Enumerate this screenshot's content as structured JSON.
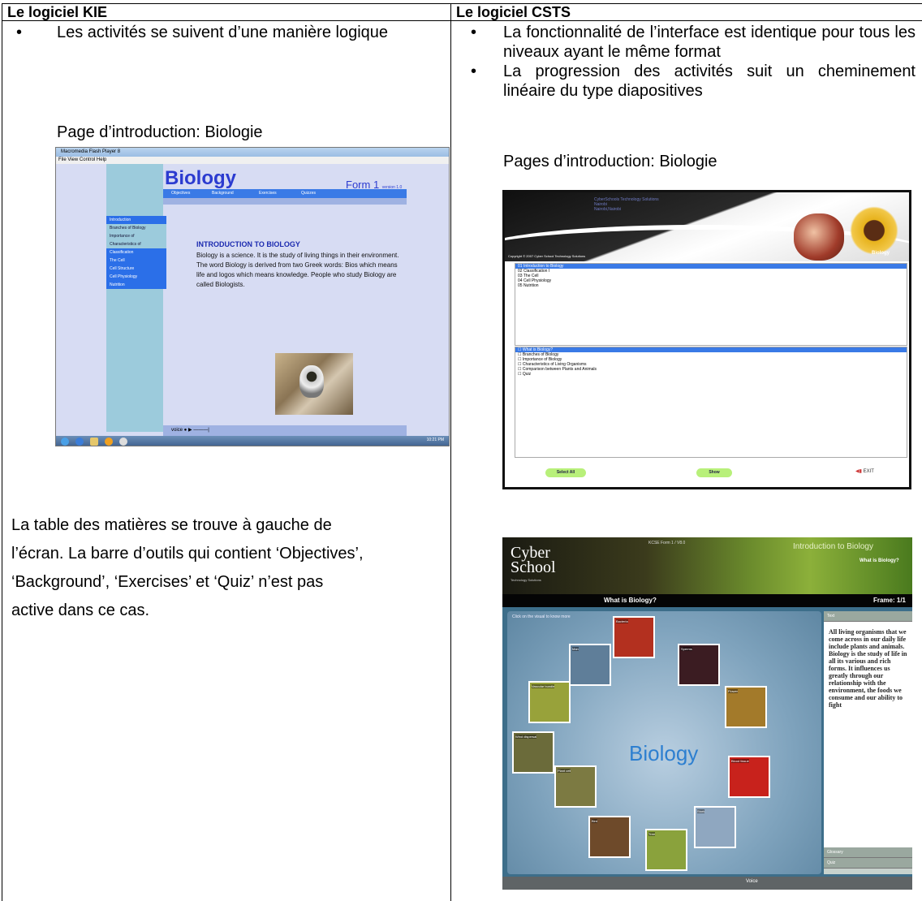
{
  "table": {
    "col1_header": "Le logiciel KIE",
    "col2_header": "Le logiciel CSTS"
  },
  "kie": {
    "bullet": "Les activités se suivent d’une manière logique",
    "caption": "Page d’introduction: Biologie",
    "paragraph_lines": [
      "La table des matières se trouve à gauche de",
      "l’écran. La barre d’outils qui contient ‘Objectives’,",
      "‘Background’, ‘Exercises’ et ‘Quiz’ n’est pas",
      "active dans ce cas."
    ],
    "screenshot": {
      "window_title": "Macromedia Flash Player 8",
      "menu": "File  View  Control  Help",
      "title": "Biology",
      "form": "Form 1",
      "form_version": "version 1.0",
      "nav": [
        "Objectives",
        "Background",
        "Exercises",
        "Quizzes"
      ],
      "toc": [
        "Introduction",
        "Branches of Biology",
        "Importance of",
        "Characteristics of",
        "Classification",
        "The Cell",
        "Cell Structure",
        "Cell Physiology",
        "Nutrition"
      ],
      "heading": "INTRODUCTION TO BIOLOGY",
      "body": "Biology is a science. It is the study of living things in their environment. The word Biology is derived from two Greek words: Bios which means life and logos which means knowledge. People who study Biology are called Biologists.",
      "voice": "voice",
      "clock": "10:21 PM"
    }
  },
  "csts": {
    "bullet1": "La fonctionnalité de l’interface est identique pour tous les niveaux ayant le même format",
    "bullet2": "La progression des activités suit un cheminement linéaire du type diapositives",
    "caption": "Pages d’introduction: Biologie",
    "screen1": {
      "company": "CyberSchools Technology Solutions",
      "city1": "Nairobi",
      "city2": "Nairobi,Nairobi",
      "copyright": "Copyright © 2007 Cyber School Technology Solutions",
      "banner_label": "Biology",
      "units": [
        "01 Introduction to Biology",
        "02 Classification I",
        "03 The Cell",
        "04 Cell Physiology",
        "05 Nutrition"
      ],
      "topics": [
        "What is Biology?",
        "Branches of Biology",
        "Importance of Biology",
        "Characteristics of Living Organisms",
        "Comparison between Plants and Animals",
        "Quiz"
      ],
      "select_all": "Select All",
      "show": "Show",
      "exit": "EXIT"
    },
    "screen2": {
      "logo1": "Cyber",
      "logo2": "School",
      "logo_sub": "Technology Solutions",
      "code": "KCSE Form 1 / V8.0",
      "section": "Introduction to Biology",
      "subsection": "What is Biology?",
      "frame_title": "What is Biology?",
      "frame": "Frame: 1/1",
      "click_hint": "Click on the visual to know more",
      "center": "Biology",
      "tiles": [
        "Bacteria",
        "Man",
        "Sperms",
        "Vascular bundle",
        "Flower",
        "Wind dispersal",
        "Plant cell",
        "Blood tissue",
        "Bird",
        "Stork",
        "Tree"
      ],
      "tab_text": "Text",
      "side_text": "All living organisms that we come across in our daily life include plants and animals. Biology is the study of life in all its various and rich forms. It influences us greatly through our relationship with the environment, the foods we consume and our ability to fight",
      "tab_glossary": "Glossary",
      "tab_quiz": "Quiz",
      "voice": "Voice"
    }
  }
}
